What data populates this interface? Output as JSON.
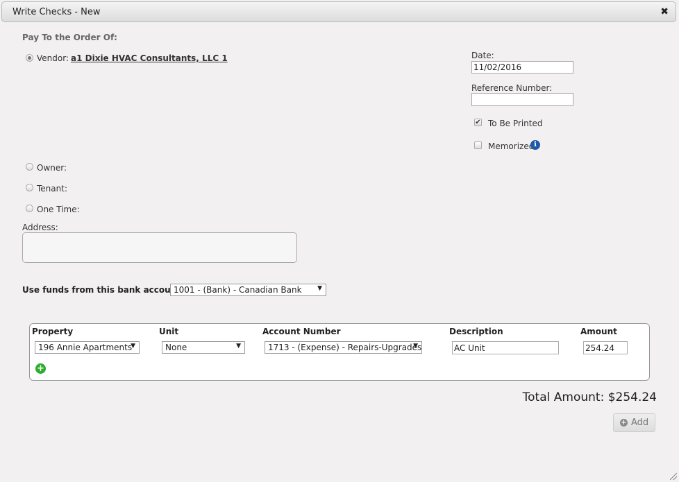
{
  "dialog": {
    "title": "Write Checks - New",
    "close_icon": "close-x"
  },
  "payee": {
    "section_label": "Pay To the Order Of:",
    "options": [
      {
        "label": "Vendor:",
        "checked": true,
        "value": "a1 Dixie HVAC Consultants, LLC 1"
      },
      {
        "label": "Owner:",
        "checked": false
      },
      {
        "label": "Tenant:",
        "checked": false
      },
      {
        "label": "One Time:",
        "checked": false
      }
    ],
    "address_label": "Address:",
    "address_value": ""
  },
  "right": {
    "date_label": "Date:",
    "date_value": "11/02/2016",
    "reference_label": "Reference Number:",
    "reference_value": "",
    "to_be_printed": {
      "label": "To Be Printed",
      "checked": true
    },
    "memorized": {
      "label": "Memorized",
      "checked": false,
      "info_icon": "info-circle"
    }
  },
  "bank": {
    "label": "Use funds from this bank account:",
    "selected": "1001 - (Bank) - Canadian Bank"
  },
  "lines": {
    "headers": [
      "Property",
      "Unit",
      "Account Number",
      "Description",
      "Amount"
    ],
    "rows": [
      {
        "property": "196 Annie Apartments",
        "unit": "None",
        "account": "1713 - (Expense) - Repairs-Upgrades",
        "description": "AC Unit",
        "amount": "254.24"
      }
    ],
    "add_row_icon": "plus-circle"
  },
  "total": {
    "text": "Total Amount: $254.24"
  },
  "add_button": {
    "label": "Add"
  }
}
